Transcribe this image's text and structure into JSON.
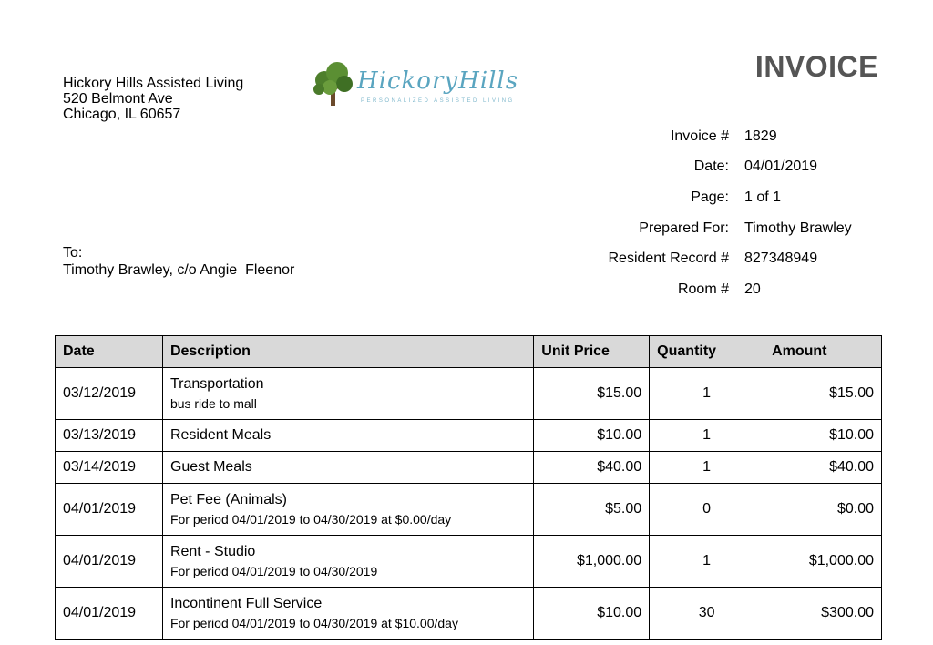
{
  "company": {
    "name": "Hickory Hills Assisted Living",
    "street": "520 Belmont Ave",
    "city": "Chicago, IL 60657"
  },
  "logo": {
    "text": "HickoryHills",
    "tagline": "PERSONALIZED ASSISTED LIVING"
  },
  "title": "INVOICE",
  "meta": [
    {
      "label": "Invoice #",
      "value": "1829"
    },
    {
      "label": "Date:",
      "value": "04/01/2019"
    },
    {
      "label": "Page:",
      "value": "1 of 1"
    },
    {
      "label": "Prepared For:",
      "value": "Timothy Brawley"
    },
    {
      "label": "Resident Record #",
      "value": "827348949"
    },
    {
      "label": "Room #",
      "value": "20"
    }
  ],
  "to": {
    "label": "To:",
    "name": "Timothy Brawley, c/o Angie  Fleenor"
  },
  "table": {
    "headers": [
      "Date",
      "Description",
      "Unit Price",
      "Quantity",
      "Amount"
    ],
    "rows": [
      {
        "date": "03/12/2019",
        "desc": "Transportation",
        "sub": "bus ride to mall",
        "unit_price": "$15.00",
        "quantity": "1",
        "amount": "$15.00"
      },
      {
        "date": "03/13/2019",
        "desc": "Resident Meals",
        "sub": "",
        "unit_price": "$10.00",
        "quantity": "1",
        "amount": "$10.00"
      },
      {
        "date": "03/14/2019",
        "desc": "Guest Meals",
        "sub": "",
        "unit_price": "$40.00",
        "quantity": "1",
        "amount": "$40.00"
      },
      {
        "date": "04/01/2019",
        "desc": "Pet Fee (Animals)",
        "sub": "For period 04/01/2019 to 04/30/2019 at $0.00/day",
        "unit_price": "$5.00",
        "quantity": "0",
        "amount": "$0.00"
      },
      {
        "date": "04/01/2019",
        "desc": "Rent - Studio",
        "sub": "For period 04/01/2019 to 04/30/2019",
        "unit_price": "$1,000.00",
        "quantity": "1",
        "amount": "$1,000.00"
      },
      {
        "date": "04/01/2019",
        "desc": "Incontinent Full Service",
        "sub": "For period 04/01/2019 to 04/30/2019 at $10.00/day",
        "unit_price": "$10.00",
        "quantity": "30",
        "amount": "$300.00"
      }
    ]
  }
}
